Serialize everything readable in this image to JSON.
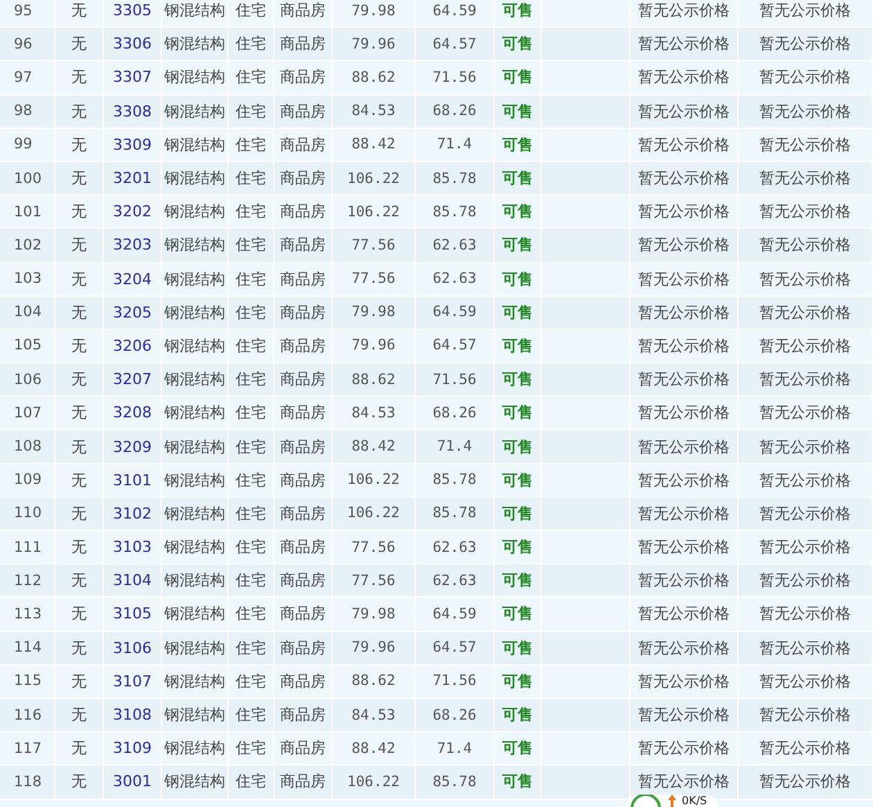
{
  "table": {
    "rows": [
      {
        "index": "95",
        "floor": "无",
        "room": "3305",
        "structure": "钢混结构",
        "usage": "住宅",
        "type": "商品房",
        "area": "79.98",
        "inner_area": "64.59",
        "status": "可售",
        "price": "暂无公示价格",
        "unit_price": "暂无公示价格"
      },
      {
        "index": "96",
        "floor": "无",
        "room": "3306",
        "structure": "钢混结构",
        "usage": "住宅",
        "type": "商品房",
        "area": "79.96",
        "inner_area": "64.57",
        "status": "可售",
        "price": "暂无公示价格",
        "unit_price": "暂无公示价格"
      },
      {
        "index": "97",
        "floor": "无",
        "room": "3307",
        "structure": "钢混结构",
        "usage": "住宅",
        "type": "商品房",
        "area": "88.62",
        "inner_area": "71.56",
        "status": "可售",
        "price": "暂无公示价格",
        "unit_price": "暂无公示价格"
      },
      {
        "index": "98",
        "floor": "无",
        "room": "3308",
        "structure": "钢混结构",
        "usage": "住宅",
        "type": "商品房",
        "area": "84.53",
        "inner_area": "68.26",
        "status": "可售",
        "price": "暂无公示价格",
        "unit_price": "暂无公示价格"
      },
      {
        "index": "99",
        "floor": "无",
        "room": "3309",
        "structure": "钢混结构",
        "usage": "住宅",
        "type": "商品房",
        "area": "88.42",
        "inner_area": "71.4",
        "status": "可售",
        "price": "暂无公示价格",
        "unit_price": "暂无公示价格"
      },
      {
        "index": "100",
        "floor": "无",
        "room": "3201",
        "structure": "钢混结构",
        "usage": "住宅",
        "type": "商品房",
        "area": "106.22",
        "inner_area": "85.78",
        "status": "可售",
        "price": "暂无公示价格",
        "unit_price": "暂无公示价格"
      },
      {
        "index": "101",
        "floor": "无",
        "room": "3202",
        "structure": "钢混结构",
        "usage": "住宅",
        "type": "商品房",
        "area": "106.22",
        "inner_area": "85.78",
        "status": "可售",
        "price": "暂无公示价格",
        "unit_price": "暂无公示价格"
      },
      {
        "index": "102",
        "floor": "无",
        "room": "3203",
        "structure": "钢混结构",
        "usage": "住宅",
        "type": "商品房",
        "area": "77.56",
        "inner_area": "62.63",
        "status": "可售",
        "price": "暂无公示价格",
        "unit_price": "暂无公示价格"
      },
      {
        "index": "103",
        "floor": "无",
        "room": "3204",
        "structure": "钢混结构",
        "usage": "住宅",
        "type": "商品房",
        "area": "77.56",
        "inner_area": "62.63",
        "status": "可售",
        "price": "暂无公示价格",
        "unit_price": "暂无公示价格"
      },
      {
        "index": "104",
        "floor": "无",
        "room": "3205",
        "structure": "钢混结构",
        "usage": "住宅",
        "type": "商品房",
        "area": "79.98",
        "inner_area": "64.59",
        "status": "可售",
        "price": "暂无公示价格",
        "unit_price": "暂无公示价格"
      },
      {
        "index": "105",
        "floor": "无",
        "room": "3206",
        "structure": "钢混结构",
        "usage": "住宅",
        "type": "商品房",
        "area": "79.96",
        "inner_area": "64.57",
        "status": "可售",
        "price": "暂无公示价格",
        "unit_price": "暂无公示价格"
      },
      {
        "index": "106",
        "floor": "无",
        "room": "3207",
        "structure": "钢混结构",
        "usage": "住宅",
        "type": "商品房",
        "area": "88.62",
        "inner_area": "71.56",
        "status": "可售",
        "price": "暂无公示价格",
        "unit_price": "暂无公示价格"
      },
      {
        "index": "107",
        "floor": "无",
        "room": "3208",
        "structure": "钢混结构",
        "usage": "住宅",
        "type": "商品房",
        "area": "84.53",
        "inner_area": "68.26",
        "status": "可售",
        "price": "暂无公示价格",
        "unit_price": "暂无公示价格"
      },
      {
        "index": "108",
        "floor": "无",
        "room": "3209",
        "structure": "钢混结构",
        "usage": "住宅",
        "type": "商品房",
        "area": "88.42",
        "inner_area": "71.4",
        "status": "可售",
        "price": "暂无公示价格",
        "unit_price": "暂无公示价格"
      },
      {
        "index": "109",
        "floor": "无",
        "room": "3101",
        "structure": "钢混结构",
        "usage": "住宅",
        "type": "商品房",
        "area": "106.22",
        "inner_area": "85.78",
        "status": "可售",
        "price": "暂无公示价格",
        "unit_price": "暂无公示价格"
      },
      {
        "index": "110",
        "floor": "无",
        "room": "3102",
        "structure": "钢混结构",
        "usage": "住宅",
        "type": "商品房",
        "area": "106.22",
        "inner_area": "85.78",
        "status": "可售",
        "price": "暂无公示价格",
        "unit_price": "暂无公示价格"
      },
      {
        "index": "111",
        "floor": "无",
        "room": "3103",
        "structure": "钢混结构",
        "usage": "住宅",
        "type": "商品房",
        "area": "77.56",
        "inner_area": "62.63",
        "status": "可售",
        "price": "暂无公示价格",
        "unit_price": "暂无公示价格"
      },
      {
        "index": "112",
        "floor": "无",
        "room": "3104",
        "structure": "钢混结构",
        "usage": "住宅",
        "type": "商品房",
        "area": "77.56",
        "inner_area": "62.63",
        "status": "可售",
        "price": "暂无公示价格",
        "unit_price": "暂无公示价格"
      },
      {
        "index": "113",
        "floor": "无",
        "room": "3105",
        "structure": "钢混结构",
        "usage": "住宅",
        "type": "商品房",
        "area": "79.98",
        "inner_area": "64.59",
        "status": "可售",
        "price": "暂无公示价格",
        "unit_price": "暂无公示价格"
      },
      {
        "index": "114",
        "floor": "无",
        "room": "3106",
        "structure": "钢混结构",
        "usage": "住宅",
        "type": "商品房",
        "area": "79.96",
        "inner_area": "64.57",
        "status": "可售",
        "price": "暂无公示价格",
        "unit_price": "暂无公示价格"
      },
      {
        "index": "115",
        "floor": "无",
        "room": "3107",
        "structure": "钢混结构",
        "usage": "住宅",
        "type": "商品房",
        "area": "88.62",
        "inner_area": "71.56",
        "status": "可售",
        "price": "暂无公示价格",
        "unit_price": "暂无公示价格"
      },
      {
        "index": "116",
        "floor": "无",
        "room": "3108",
        "structure": "钢混结构",
        "usage": "住宅",
        "type": "商品房",
        "area": "84.53",
        "inner_area": "68.26",
        "status": "可售",
        "price": "暂无公示价格",
        "unit_price": "暂无公示价格"
      },
      {
        "index": "117",
        "floor": "无",
        "room": "3109",
        "structure": "钢混结构",
        "usage": "住宅",
        "type": "商品房",
        "area": "88.42",
        "inner_area": "71.4",
        "status": "可售",
        "price": "暂无公示价格",
        "unit_price": "暂无公示价格"
      },
      {
        "index": "118",
        "floor": "无",
        "room": "3001",
        "structure": "钢混结构",
        "usage": "住宅",
        "type": "商品房",
        "area": "106.22",
        "inner_area": "85.78",
        "status": "可售",
        "price": "暂无公示价格",
        "unit_price": "暂无公示价格"
      }
    ]
  },
  "speed_widget": {
    "reading": "0K/S"
  }
}
